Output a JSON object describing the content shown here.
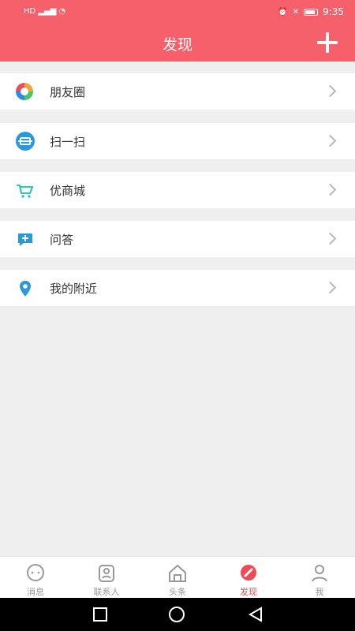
{
  "status": {
    "left": "HD",
    "time": "9:35"
  },
  "header": {
    "title": "发现"
  },
  "menu": {
    "items": [
      {
        "label": "朋友圈",
        "icon": "moments-camera-icon"
      },
      {
        "label": "扫一扫",
        "icon": "scan-icon"
      },
      {
        "label": "优商城",
        "icon": "shopping-cart-icon"
      },
      {
        "label": "问答",
        "icon": "question-answer-icon"
      },
      {
        "label": "我的附近",
        "icon": "location-pin-icon"
      }
    ]
  },
  "tabbar": {
    "items": [
      {
        "label": "消息",
        "icon": "message-icon"
      },
      {
        "label": "联系人",
        "icon": "contacts-icon"
      },
      {
        "label": "头条",
        "icon": "headline-icon"
      },
      {
        "label": "发现",
        "icon": "discover-icon",
        "active": true
      },
      {
        "label": "我",
        "icon": "profile-icon"
      }
    ]
  },
  "colors": {
    "accent": "#f5606a",
    "active_tab": "#ef4b57",
    "scan_blue": "#2a98d9",
    "cart_teal": "#3cc1b8"
  }
}
